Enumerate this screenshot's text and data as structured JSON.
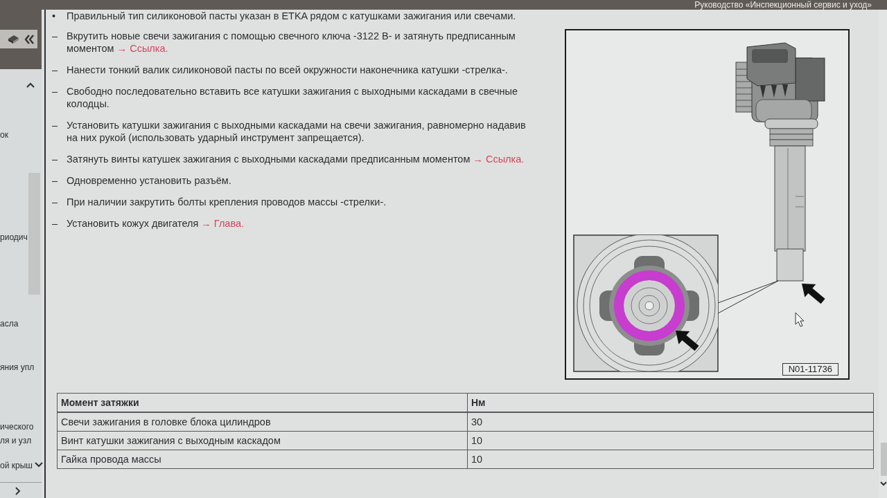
{
  "header": {
    "title": "Руководство «Инспекционный сервис и уход»"
  },
  "sidebar": {
    "items": [
      {
        "text": "ок"
      },
      {
        "text": "риодич"
      },
      {
        "text": "асла"
      },
      {
        "text": "яния упл"
      },
      {
        "text": "ического"
      },
      {
        "text": "ля и узл"
      },
      {
        "text": "ой крыш"
      }
    ]
  },
  "note": {
    "marker": "•",
    "text": "Правильный тип силиконовой пасты указан в ETKA рядом с катушками зажигания или свечами."
  },
  "steps": [
    {
      "marker": "–",
      "text": "Вкрутить новые свечи зажигания с помощью свечного ключа -3122 B- и затянуть предписанным моментом",
      "link": "→ Ссылка."
    },
    {
      "marker": "–",
      "text": "Нанести тонкий валик силиконовой пасты по всей окружности наконечника катушки -стрелка-."
    },
    {
      "marker": "–",
      "text": "Свободно последовательно вставить все катушки зажигания с выходными каскадами в свечные колодцы."
    },
    {
      "marker": "–",
      "text": "Установить катушки зажигания с выходными каскадами на свечи зажигания, равномерно надавив на них рукой (использовать ударный инструмент запрещается)."
    },
    {
      "marker": "–",
      "text": "Затянуть винты катушек зажигания с выходными каскадами предписанным моментом",
      "link": "→ Ссылка."
    },
    {
      "marker": "–",
      "text": "Одновременно установить разъём."
    },
    {
      "marker": "–",
      "text": "При наличии закрутить болты крепления проводов массы -стрелки-."
    },
    {
      "marker": "–",
      "text": "Установить кожух двигателя",
      "link": "→ Глава."
    }
  ],
  "figure": {
    "code": "N01-11736"
  },
  "table": {
    "columns": [
      "Момент затяжки",
      "Нм"
    ],
    "rows": [
      [
        "Свечи зажигания в головке блока цилиндров",
        "30"
      ],
      [
        "Винт катушки зажигания с выходным каскадом",
        "10"
      ],
      [
        "Гайка провода массы",
        "10"
      ]
    ]
  }
}
